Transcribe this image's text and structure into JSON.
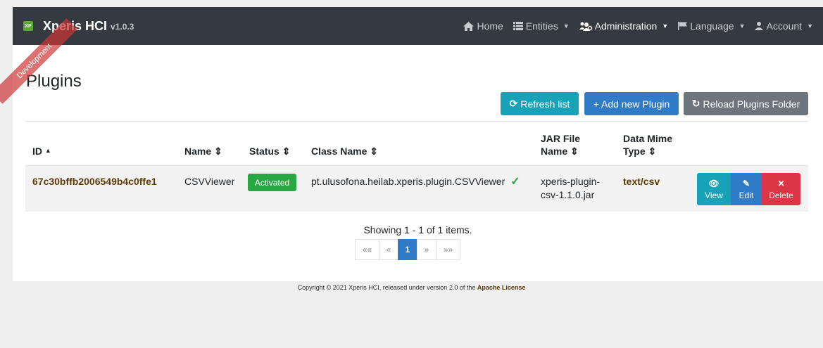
{
  "brand": {
    "logo": "XP",
    "name": "Xperis HCI",
    "version": "v1.0.3"
  },
  "nav": {
    "home": "Home",
    "entities": "Entities",
    "administration": "Administration",
    "language": "Language",
    "account": "Account"
  },
  "ribbon": "Development",
  "page": {
    "title": "Plugins",
    "refresh_label": "Refresh list",
    "add_label": "+ Add new Plugin",
    "reload_label": "Reload Plugins Folder"
  },
  "table": {
    "headers": {
      "id": "ID",
      "name": "Name",
      "status": "Status",
      "class_name": "Class Name",
      "jar_line1": "JAR File",
      "jar_line2": "Name",
      "mime_line1": "Data Mime",
      "mime_line2": "Type"
    },
    "rows": [
      {
        "id": "67c30bffb2006549b4c0ffe1",
        "name": "CSVViewer",
        "status": "Activated",
        "class_name": "pt.ulusofona.heilab.xperis.plugin.CSVViewer",
        "jar_line1": "xperis-plugin-",
        "jar_line2": "csv-1.1.0.jar",
        "mime": "text/csv",
        "view": "View",
        "edit": "Edit",
        "delete": "Delete"
      }
    ]
  },
  "pagination": {
    "showing": "Showing 1 - 1 of 1 items.",
    "first": "««",
    "prev": "«",
    "current": "1",
    "next": "»",
    "last": "»»"
  },
  "footer": {
    "text": "Copyright © 2021 Xperis HCI, released under version 2.0 of the",
    "license": "Apache License"
  },
  "colors": {
    "navbar": "#353a40",
    "info": "#17a2b8",
    "primary": "#2f7bc7",
    "secondary": "#6c757d",
    "success": "#28a745",
    "danger": "#dc3545",
    "id_text": "#5b3a06"
  }
}
